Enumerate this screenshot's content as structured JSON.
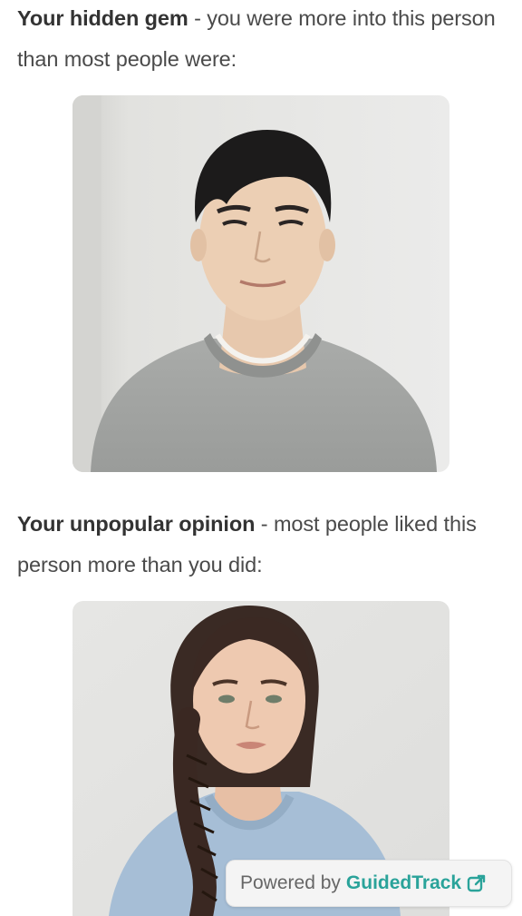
{
  "hidden_gem": {
    "heading": "Your hidden gem",
    "text": " - you were more into this person than most people were:"
  },
  "unpopular_opinion": {
    "heading": "Your unpopular opinion",
    "text": " - most people liked this person more than you did:"
  },
  "footer": {
    "prefix": "Powered by",
    "brand": "GuidedTrack",
    "icon": "external-link-icon"
  },
  "colors": {
    "brand": "#2aa39a",
    "text": "#4a4a4a"
  }
}
